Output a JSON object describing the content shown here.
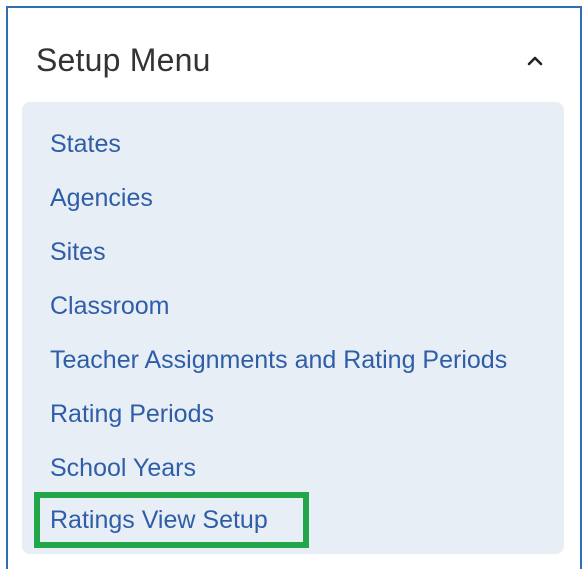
{
  "setup_menu": {
    "title": "Setup Menu",
    "toggle_icon": "chevron-up-icon",
    "items": [
      {
        "label": "States"
      },
      {
        "label": "Agencies"
      },
      {
        "label": "Sites"
      },
      {
        "label": "Classroom"
      },
      {
        "label": "Teacher Assignments and Rating Periods"
      },
      {
        "label": "Rating Periods"
      },
      {
        "label": "School Years"
      },
      {
        "label": "Ratings View Setup"
      }
    ]
  },
  "colors": {
    "panel_border": "#2f6fb3",
    "menu_background": "#e8eef5",
    "link": "#2e5ea8",
    "highlight": "#22a64a"
  }
}
